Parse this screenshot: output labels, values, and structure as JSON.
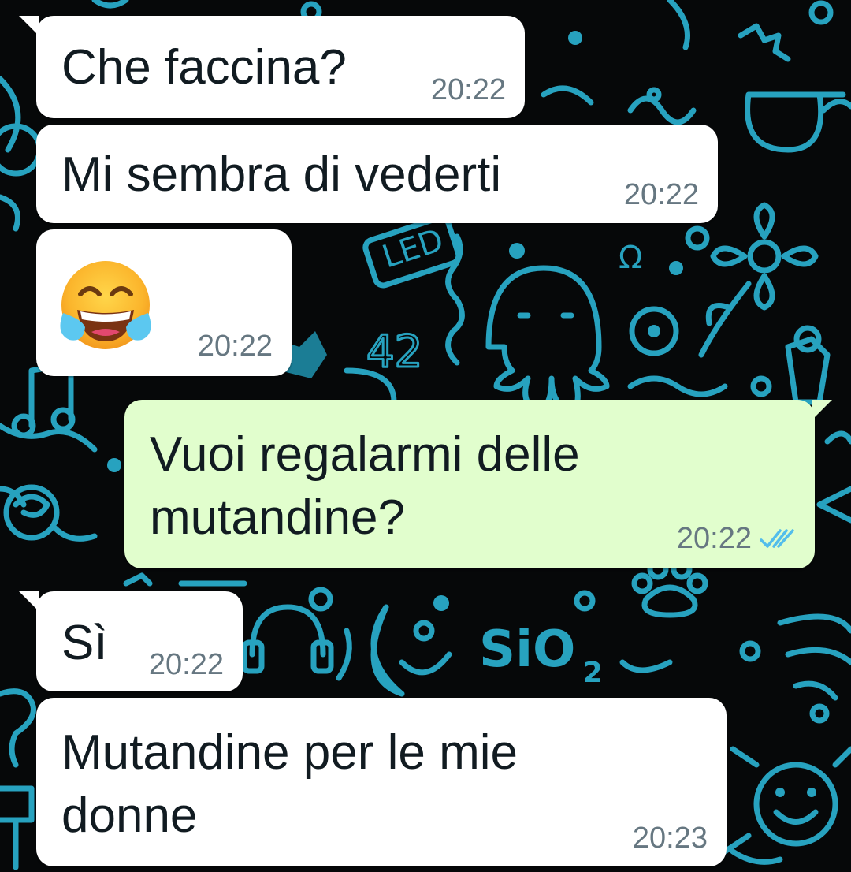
{
  "colors": {
    "wallpaper_bg": "#060809",
    "doodle_accent": "#2aa8c4",
    "incoming_bubble": "#ffffff",
    "outgoing_bubble": "#e1fecd",
    "timestamp": "#667781",
    "read_ticks": "#53bdeb"
  },
  "messages": [
    {
      "direction": "incoming",
      "text": "Che faccina?",
      "time": "20:22"
    },
    {
      "direction": "incoming",
      "text": "Mi sembra di vederti",
      "time": "20:22"
    },
    {
      "direction": "incoming",
      "emoji": "face-with-tears-of-joy-icon",
      "text": "😂",
      "time": "20:22"
    },
    {
      "direction": "outgoing",
      "text": "Vuoi regalarmi delle\nmutandine?",
      "time": "20:22",
      "status": "read"
    },
    {
      "direction": "incoming",
      "text": "Sì",
      "time": "20:22"
    },
    {
      "direction": "incoming",
      "text": "Mutandine per le mie\ndonne",
      "time": "20:23"
    }
  ],
  "wallpaper": {
    "doodle_texts": [
      "42",
      "SiO",
      "2"
    ]
  }
}
